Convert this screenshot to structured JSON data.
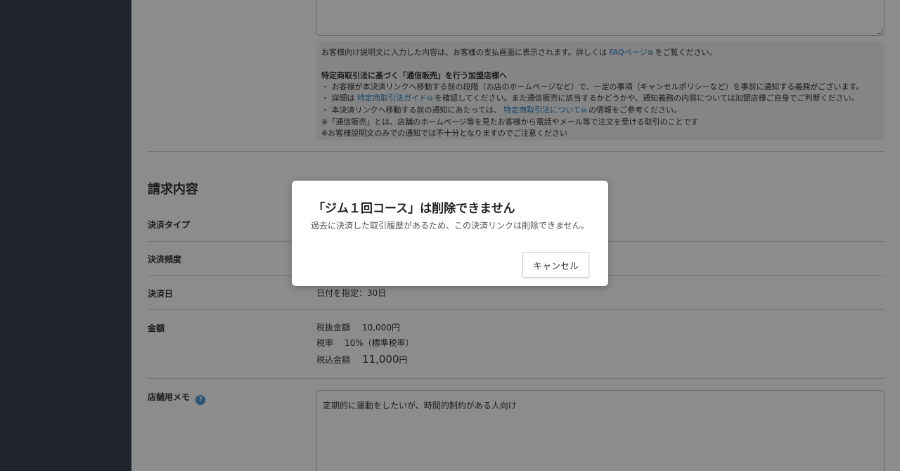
{
  "form": {
    "notice": {
      "intro_text": "お客様向け説明文に入力した内容は、お客様の支払画面に表示されます。詳しくは",
      "intro_link": "FAQページ",
      "intro_suffix": "をご覧ください。",
      "heading": "特定商取引法に基づく「通信販売」を行う加盟店様へ",
      "bullet1": "・ お客様が本決済リンクへ移動する前の段階（お店のホームページなど）で、一定の事項（キャンセルポリシーなど）を事前に通知する義務がございます。",
      "bullet2_prefix": "・ 詳細は",
      "bullet2_link": "特定商取引法ガイド",
      "bullet2_suffix": "を確認してください。また通信販売に該当するかどうかや、通知義務の内容については加盟店様ご自身でご判断ください。",
      "bullet3_prefix": "・ 本決済リンクへ移動する前の通知にあたっては、",
      "bullet3_link": "特定商取引法について",
      "bullet3_suffix": "の情報をご参考ください。",
      "note1": "※「通信販売」とは、店舗のホームページ等を見たお客様から電話やメール等で注文を受ける取引のことです",
      "note2": "※お客様説明文のみでの通知では不十分となりますのでご注意ください"
    },
    "billing_section_title": "請求内容",
    "payment_type_label": "決済タイプ",
    "payment_frequency_label": "決済頻度",
    "payment_date_label": "決済日",
    "payment_date_value": "日付を指定：30日",
    "amount_label": "金額",
    "amount_excl_label": "税抜金額",
    "amount_excl_value": "10,000円",
    "tax_rate_label": "税率",
    "tax_rate_value": "10%（標準税率）",
    "amount_incl_label": "税込金額",
    "amount_incl_value": "11,000",
    "amount_incl_unit": "円",
    "store_memo_label": "店舗用メモ",
    "store_memo_value": "定期的に運動をしたいが、時間的制約がある人向け"
  },
  "modal": {
    "title": "「ジム１回コース」は削除できません",
    "message": "過去に決済した取引履歴があるため、この決済リンクは削除できません。",
    "cancel_label": "キャンセル"
  }
}
